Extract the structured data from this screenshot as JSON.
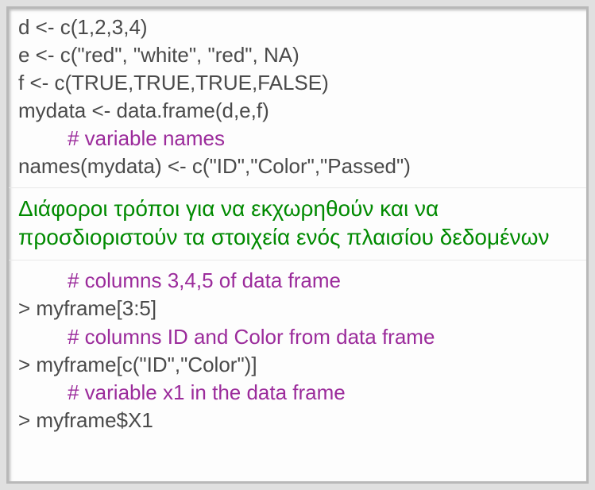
{
  "code_top": {
    "line1": "d <- c(1,2,3,4)",
    "line2": "e <- c(\"red\", \"white\", \"red\", NA)",
    "line3": "f <- c(TRUE,TRUE,TRUE,FALSE)",
    "line4": "mydata <- data.frame(d,e,f)",
    "comment1": "# variable names",
    "line5": "names(mydata) <- c(\"ID\",\"Color\",\"Passed\")"
  },
  "heading": "Διάφοροι τρόποι για να εκχωρηθούν και να προσδιοριστούν τα στοιχεία ενός πλαισίου δεδομένων",
  "code_bot": {
    "comment1": "# columns 3,4,5 of data frame",
    "line1": "> myframe[3:5]",
    "comment2": "# columns ID and Color from data frame",
    "line2": "> myframe[c(\"ID\",\"Color\")]",
    "comment3": "# variable x1 in the data frame",
    "line3": "> myframe$X1"
  }
}
